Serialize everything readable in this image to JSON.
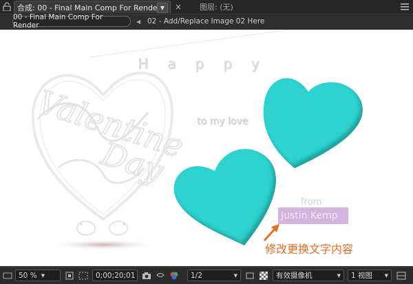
{
  "tabs": {
    "active_label": "合成: 00 - Final Main Comp For Render",
    "dropdown_glyph": "▼",
    "close_glyph": "×",
    "layer_label": "图层: (无)"
  },
  "breadcrumb": {
    "current": "00 - Final Main Comp For Render",
    "separator": "◀",
    "next": "02 - Add/Replace Image 02 Here"
  },
  "composition": {
    "happy_text": "Happy",
    "script_text": "Valentine's Day",
    "to_text": "to my love",
    "from_text": "from",
    "name_text": "Justin Kemp",
    "heart_color": "#2ed3cf",
    "annotation": "修改更换文字内容",
    "annotation_color": "#ec6b1c"
  },
  "statusbar": {
    "zoom": "50 %",
    "timecode": "0;00;20;01",
    "resolution": "1/2",
    "camera": "有效摄像机",
    "views": "1 视图"
  }
}
